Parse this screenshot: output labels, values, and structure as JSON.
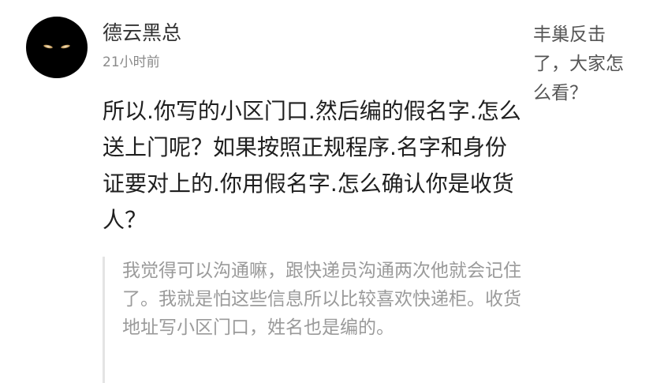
{
  "comment": {
    "username": "德云黑总",
    "time": "21小时前",
    "text": "所以.你写的小区门口.然后编的假名字.怎么送上门呢？如果按照正规程序.名字和身份证要对上的.你用假名字.怎么确认你是收货人？",
    "quote": "我觉得可以沟通嘛，跟快递员沟通两次他就会记住了。我就是怕这些信息所以比较喜欢快递柜。收货地址写小区门口，姓名也是编的。"
  },
  "side": {
    "title": "丰巢反击了，大家怎么看？"
  }
}
